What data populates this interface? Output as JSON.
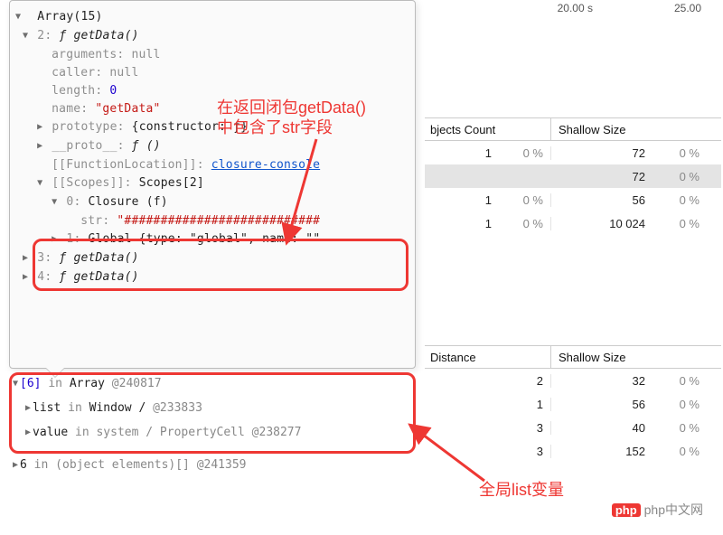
{
  "timeline": {
    "t1": "20.00 s",
    "t2": "25.00"
  },
  "table1": {
    "colA": "bjects Count",
    "colB": "Shallow Size",
    "rows": [
      {
        "count": "1",
        "cp": "0 %",
        "size": "72",
        "sp": "0 %",
        "hl": false
      },
      {
        "count": "",
        "cp": "",
        "size": "72",
        "sp": "0 %",
        "hl": true
      },
      {
        "count": "1",
        "cp": "0 %",
        "size": "56",
        "sp": "0 %",
        "hl": false
      },
      {
        "count": "1",
        "cp": "0 %",
        "size": "10 024",
        "sp": "0 %",
        "hl": false
      }
    ]
  },
  "table2": {
    "colA": "Distance",
    "colB": "Shallow Size",
    "rows": [
      {
        "d": "2",
        "size": "32",
        "sp": "0 %"
      },
      {
        "d": "1",
        "size": "56",
        "sp": "0 %"
      },
      {
        "d": "3",
        "size": "40",
        "sp": "0 %"
      },
      {
        "d": "3",
        "size": "152",
        "sp": "0 %"
      }
    ]
  },
  "console": {
    "header": "Array(15)",
    "l2_idx": "2",
    "l2_fn": "getData()",
    "arguments_k": "arguments",
    "arguments_v": "null",
    "caller_k": "caller",
    "caller_v": "null",
    "length_k": "length",
    "length_v": "0",
    "name_k": "name",
    "name_v": "\"getData\"",
    "proto_k": "prototype",
    "proto_v": "{constructor: ƒ}",
    "dproto_k": "__proto__",
    "dproto_v": "ƒ ()",
    "flloc_k": "[[FunctionLocation]]",
    "flloc_v": "closure-console",
    "scopes_k": "[[Scopes]]",
    "scopes_v": "Scopes[2]",
    "scope0_idx": "0",
    "scope0_v": "Closure (f)",
    "str_k": "str",
    "str_v": "\"###########################",
    "scope1_idx": "1",
    "scope1_v": "Global {type: \"global\", name: \"\"",
    "l3_idx": "3",
    "l3_fn": "getData()",
    "l4_idx": "4",
    "l4_fn": "getData()"
  },
  "retainers": {
    "r1_idx": "[6]",
    "r1_in": " in ",
    "r1_obj": "Array ",
    "r1_at": "@240817",
    "r2_k": "list",
    "r2_in": " in ",
    "r2_obj": "Window / ",
    "r2_at": "@233833",
    "r3_k": "value",
    "r3_in": " in system / PropertyCell ",
    "r3_at": "@238277",
    "r4_k": "6",
    "r4_in": " in (object elements)[] ",
    "r4_at": "@241359"
  },
  "annotation1_l1": "在返回闭包getData()",
  "annotation1_l2": "中包含了str字段",
  "annotation2": "全局list变量",
  "watermark": "php中文网"
}
